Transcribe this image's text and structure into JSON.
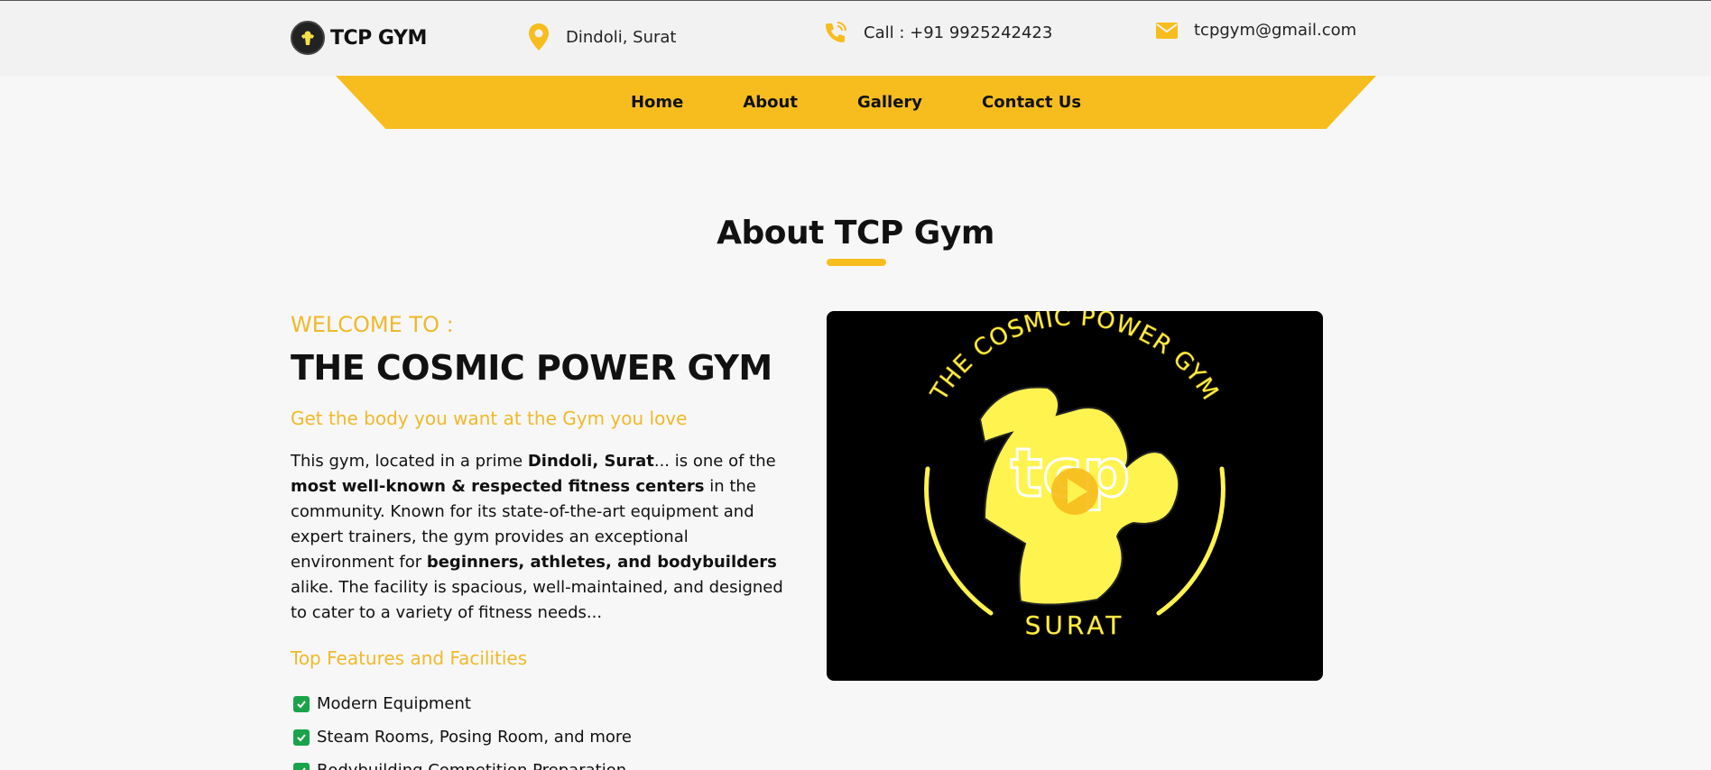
{
  "header": {
    "logo_text": "TCP GYM",
    "location": "Dindoli, Surat",
    "phone": "Call : +91 9925242423",
    "email": "tcpgym@gmail.com"
  },
  "nav": {
    "items": [
      {
        "label": "Home"
      },
      {
        "label": "About"
      },
      {
        "label": "Gallery"
      },
      {
        "label": "Contact Us"
      }
    ]
  },
  "about": {
    "title": "About TCP Gym",
    "welcome": "WELCOME TO :",
    "gym_name": "THE COSMIC POWER GYM",
    "tagline": "Get the body you want at the Gym you love",
    "desc": {
      "p1": "This gym, located in a prime ",
      "b1": "Dindoli, Surat",
      "p2": "... is one of the ",
      "b2": "most well-known & respected fitness centers",
      "p3": " in the community. Known for its state-of-the-art equipment and expert trainers, the gym provides an exceptional environment for ",
      "b3": "beginners, athletes, and bodybuilders",
      "p4": " alike. The facility is spacious, well-maintained, and designed to cater to a variety of fitness needs..."
    },
    "features_title": "Top Features and Facilities",
    "features": [
      "Modern Equipment",
      "Steam Rooms, Posing Room, and more",
      "Bodybuilding Competition Preparation"
    ]
  },
  "video": {
    "arc_text": "THE COSMIC POWER GYM",
    "bottom_text": "SURAT",
    "monogram": "tcp"
  },
  "colors": {
    "accent": "#f7bd1e",
    "neon_yellow": "#fff350",
    "check_green": "#1aa34a"
  }
}
